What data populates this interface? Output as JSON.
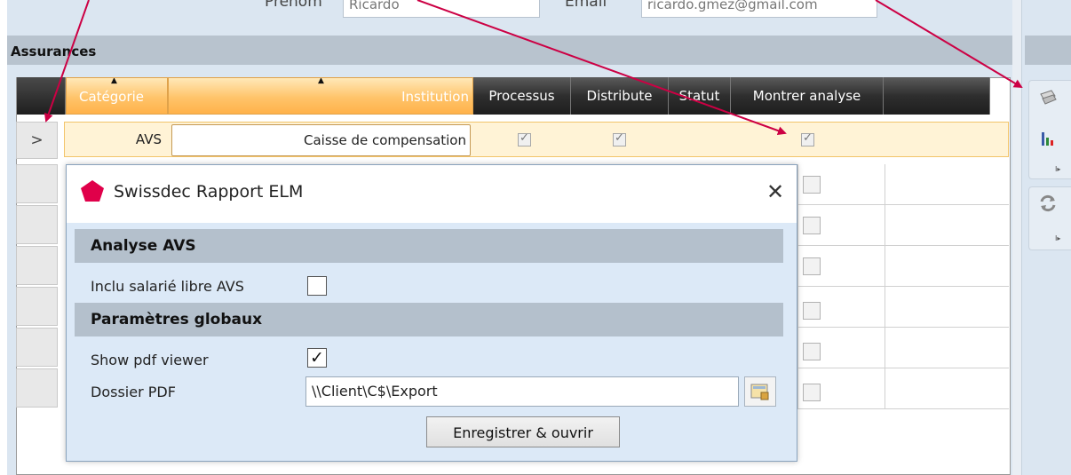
{
  "top_form": {
    "prenom_label": "Prénom",
    "prenom_value": "Ricardo",
    "email_label": "Email",
    "email_value": "ricardo.gmez@gmail.com"
  },
  "section": {
    "title": "Assurances"
  },
  "grid": {
    "columns": [
      {
        "label": "Catégorie",
        "sorted": true
      },
      {
        "label": "Institution",
        "sorted": true
      },
      {
        "label": "Processus"
      },
      {
        "label": "Distribute"
      },
      {
        "label": "Statut"
      },
      {
        "label": "Montrer analyse"
      }
    ],
    "selected_row": {
      "indicator": ">",
      "categorie": "AVS",
      "institution": "Caisse de compensation",
      "processus_checked": true,
      "distribute_checked": true,
      "montrer_analyse_checked": true
    }
  },
  "dialog": {
    "title": "Swissdec Rapport ELM",
    "close_glyph": "✕",
    "section_analyse": "Analyse AVS",
    "inclu_label": "Inclu salarié libre AVS",
    "inclu_checked": false,
    "section_globaux": "Paramètres globaux",
    "show_pdf_label": "Show pdf viewer",
    "show_pdf_checked": true,
    "dossier_label": "Dossier PDF",
    "dossier_value": "\\\\Client\\C$\\Export",
    "save_button": "Enregistrer & ouvrir"
  },
  "colors": {
    "accent_orange": "#ffc46a",
    "dialog_bg": "#dce9f7",
    "arrow": "#cc0044",
    "logo": "#e0004a"
  },
  "icons": [
    "chart-icon",
    "refresh-icon",
    "settings-icon",
    "folder-browse-icon",
    "swissdec-logo-icon"
  ]
}
